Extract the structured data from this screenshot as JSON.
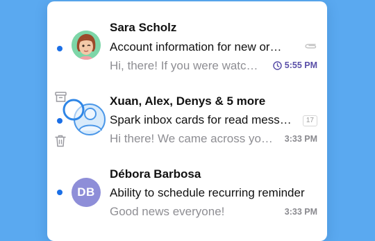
{
  "colors": {
    "background": "#5aa9f0",
    "unread_dot": "#1b6fe6",
    "snooze": "#5a4fa8"
  },
  "emails": [
    {
      "sender": "Sara Scholz",
      "subject": "Account information for new or…",
      "preview": "Hi, there! If you were watc…",
      "time": "5:55 PM",
      "time_icon": "clock-icon",
      "trailing_icon": "paperclip-icon",
      "unread": true
    },
    {
      "sender": "Xuan, Alex, Denys & 5 more",
      "subject": "Spark inbox cards for read mess…",
      "preview": "Hi there! We came across yo…",
      "time": "3:33 PM",
      "count_badge": "17",
      "unread": true,
      "swipe_actions": [
        "archive-icon",
        "trash-icon"
      ]
    },
    {
      "sender": "Débora Barbosa",
      "avatar_initials": "DB",
      "subject": "Ability to schedule recurring reminder",
      "preview": "Good news everyone!",
      "time": "3:33 PM",
      "unread": true
    }
  ]
}
